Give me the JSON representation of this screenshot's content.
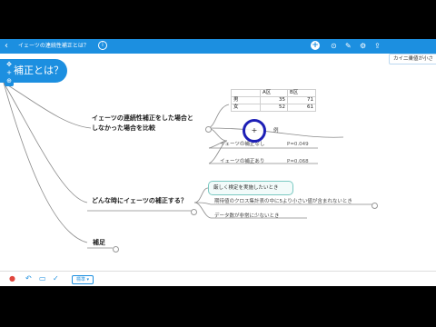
{
  "topbar": {
    "title": "イェーツの連続性補正とは？",
    "back_glyph": "‹",
    "info_glyph": "i",
    "add_glyph": "+",
    "colors": {
      "bar": "#1c8fe0"
    }
  },
  "toolbox": {
    "items": [
      "✥",
      "+",
      "⊕"
    ]
  },
  "root": {
    "label": "補正とは？"
  },
  "corner_node": {
    "label": "カイ二乗値が小さ"
  },
  "branches": {
    "compare": {
      "label_line1": "イェーツの連続性補正をした場合と",
      "label_line2": "しなかった場合を比較"
    },
    "example": {
      "label": "例"
    },
    "without": {
      "label": "イェーツの補正なし",
      "p": "P=0.049"
    },
    "with": {
      "label": "イェーツの補正あり",
      "p": "P=0.068"
    },
    "when": {
      "label": "どんな時にイェーツの補正する？"
    },
    "when_items": [
      "厳しく検定を実施したいとき",
      "期待値のクロス集計表の中に5より小さい値が含まれないとき",
      "データ数が非常に少ないとき"
    ],
    "supplement": {
      "label": "補足"
    }
  },
  "table": {
    "headers": [
      "",
      "A区",
      "B区"
    ],
    "rows": [
      [
        "男",
        "35",
        "71"
      ],
      [
        "女",
        "52",
        "61"
      ]
    ]
  },
  "cursor": {
    "glyph": "+"
  },
  "bottombar": {
    "zoom_label": "標準 ▾"
  }
}
